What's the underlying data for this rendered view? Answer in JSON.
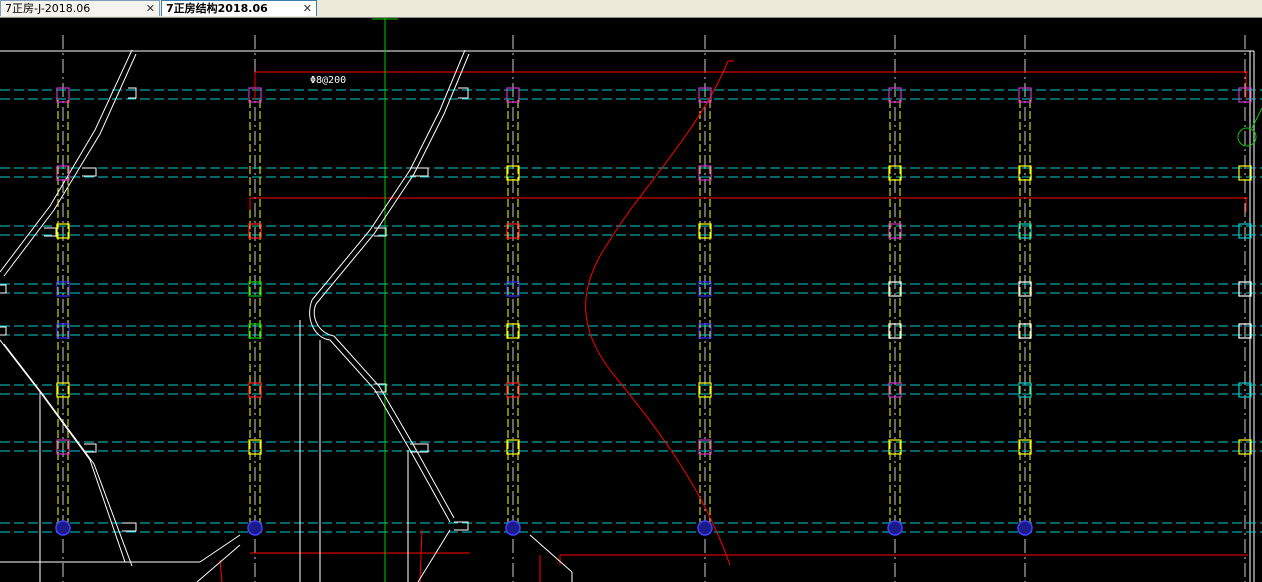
{
  "tabs": [
    {
      "label": "7正房-J-2018.06",
      "close": "✕",
      "active": false
    },
    {
      "label": "7正房结构2018.06",
      "close": "✕",
      "active": true
    }
  ],
  "annotations": {
    "rebar_spec": "Φ8@200"
  },
  "icons": {
    "tab_close": "close-icon"
  },
  "colors": {
    "background": "#000000",
    "outline": "#ffffff",
    "beam": "#ff0000",
    "axis": "#00ffff",
    "column_frame": "#ffff00",
    "column_magenta": "#cc33cc",
    "column_blue": "#2020ff",
    "guide": "#00cc00"
  }
}
